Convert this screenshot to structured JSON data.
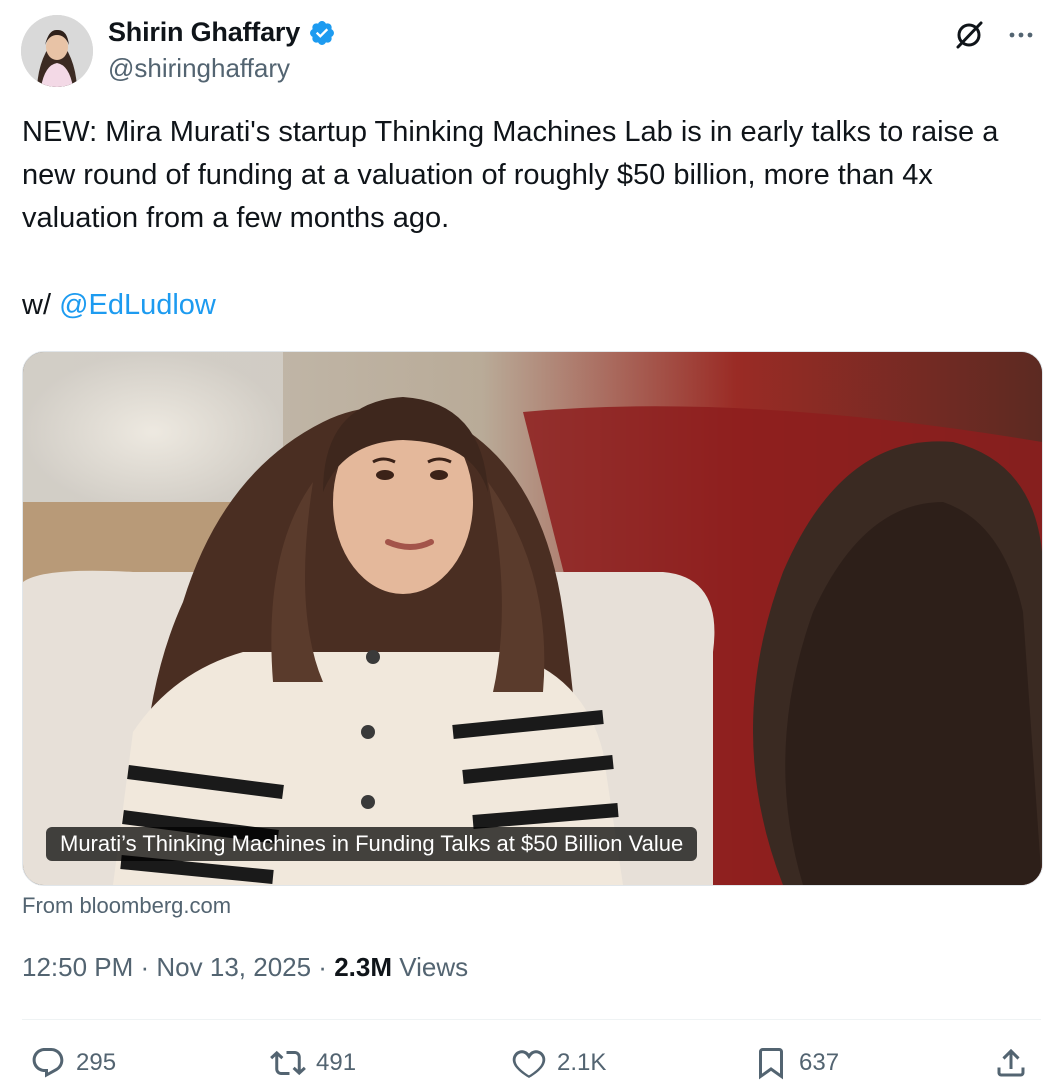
{
  "author": {
    "display_name": "Shirin Ghaffary",
    "handle": "@shiringhaffary",
    "verified": true
  },
  "tweet": {
    "text": "NEW: Mira Murati's startup Thinking Machines Lab is in early talks to raise a new round of funding at a valuation of roughly $50 billion, more than 4x valuation from a few months ago.",
    "with_prefix": "w/ ",
    "mention": "@EdLudlow"
  },
  "card": {
    "headline": "Murati’s Thinking Machines in Funding Talks at $50 Billion Value",
    "source": "From bloomberg.com"
  },
  "meta": {
    "time": "12:50 PM",
    "separator": " · ",
    "date": "Nov 13, 2025",
    "views_count": "2.3M",
    "views_label": " Views"
  },
  "actions": {
    "replies": "295",
    "reposts": "491",
    "likes": "2.1K",
    "bookmarks": "637"
  },
  "colors": {
    "accent": "#1d9bf0",
    "secondary_text": "#536471",
    "primary_text": "#0f1419"
  },
  "icons": [
    "verified-badge-icon",
    "grok-icon",
    "more-icon",
    "reply-icon",
    "repost-icon",
    "like-icon",
    "bookmark-icon",
    "share-icon"
  ]
}
